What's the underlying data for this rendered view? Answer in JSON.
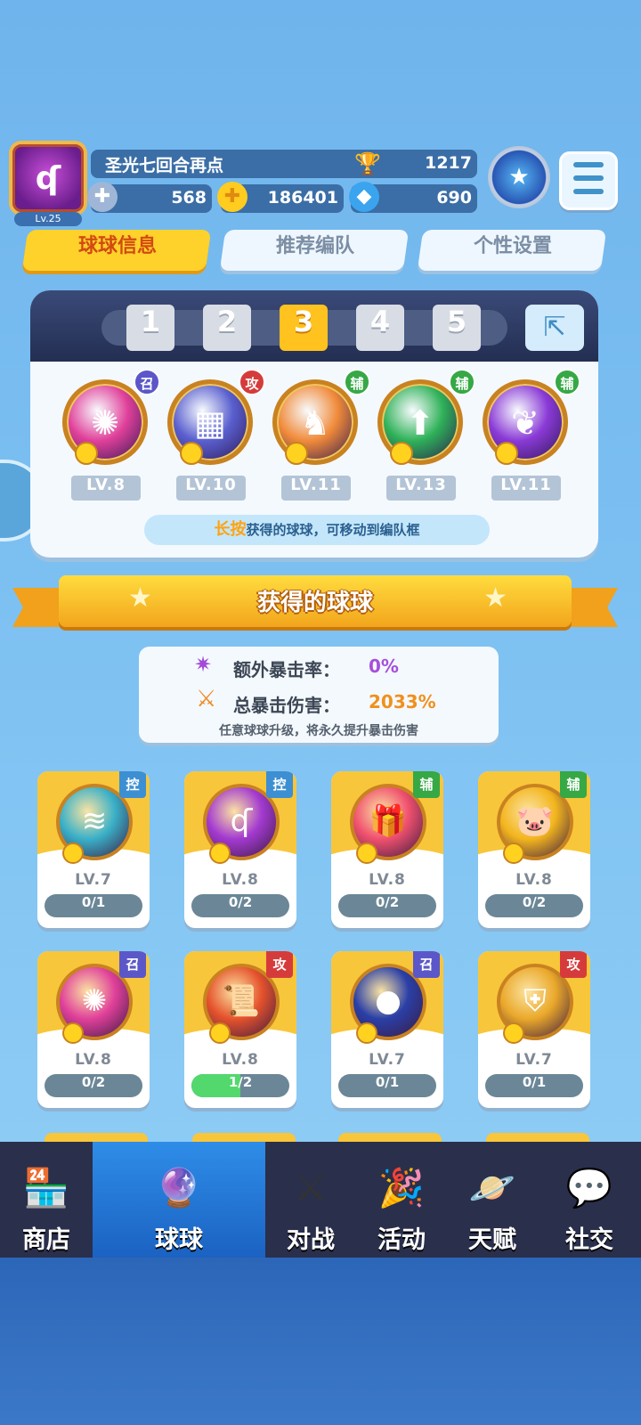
{
  "player": {
    "level": "Lv.25",
    "name": "圣光七回合再点",
    "trophies": "1217",
    "stamina": "568",
    "coins": "186401",
    "gems": "690"
  },
  "tabs": [
    {
      "label": "球球信息",
      "active": true
    },
    {
      "label": "推荐编队",
      "active": false
    },
    {
      "label": "个性设置",
      "active": false
    }
  ],
  "team": {
    "slots": [
      "1",
      "2",
      "3",
      "4",
      "5"
    ],
    "active_slot": 3,
    "balls": [
      {
        "icon": "phoenix-icon",
        "tag": "召",
        "level": "LV.8",
        "color": "#e0409a"
      },
      {
        "icon": "pixel-block-icon",
        "tag": "攻",
        "level": "LV.10",
        "color": "#5a5fcf"
      },
      {
        "icon": "silhouette-icon",
        "tag": "辅",
        "level": "LV.11",
        "color": "#f08a3a"
      },
      {
        "icon": "arrow-star-icon",
        "tag": "辅",
        "level": "LV.13",
        "color": "#2fb158"
      },
      {
        "icon": "leaf-icon",
        "tag": "辅",
        "level": "LV.11",
        "color": "#8a3ad6"
      }
    ],
    "hint_highlight": "长按",
    "hint_rest": "获得的球球，可移动到编队框"
  },
  "section": {
    "title": "获得的球球"
  },
  "crit": {
    "extra_label": "额外暴击率：",
    "extra_value": "0%",
    "total_label": "总暴击伤害：",
    "total_value": "2033%",
    "note": "任意球球升级，将永久提升暴击伤害"
  },
  "cards": [
    {
      "icon": "swirl-icon",
      "tag": "控",
      "level": "LV.7",
      "progress": "0/1",
      "fill": 0,
      "color": "#3ab0c8"
    },
    {
      "icon": "q-rune-icon",
      "tag": "控",
      "level": "LV.8",
      "progress": "0/2",
      "fill": 0,
      "color": "#a33ad0"
    },
    {
      "icon": "gift-icon",
      "tag": "辅",
      "level": "LV.8",
      "progress": "0/2",
      "fill": 0,
      "color": "#f0506e"
    },
    {
      "icon": "piggy-bank-icon",
      "tag": "辅",
      "level": "LV.8",
      "progress": "0/2",
      "fill": 0,
      "color": "#f3b51e"
    },
    {
      "icon": "phoenix-icon",
      "tag": "召",
      "level": "LV.8",
      "progress": "0/2",
      "fill": 0,
      "color": "#e0409a"
    },
    {
      "icon": "scroll-icon",
      "tag": "攻",
      "level": "LV.8",
      "progress": "1/2",
      "fill": 0.5,
      "color": "#e5522c"
    },
    {
      "icon": "dark-orb-icon",
      "tag": "召",
      "level": "LV.7",
      "progress": "0/1",
      "fill": 0,
      "color": "#2a3fa6"
    },
    {
      "icon": "armor-icon",
      "tag": "攻",
      "level": "LV.7",
      "progress": "0/1",
      "fill": 0,
      "color": "#eaa82a"
    }
  ],
  "nav": [
    {
      "label": "商店",
      "icon": "shop-icon",
      "active": false
    },
    {
      "label": "球球",
      "icon": "balls-icon",
      "active": true
    },
    {
      "label": "对战",
      "icon": "crossed-swords-icon",
      "active": false
    },
    {
      "label": "活动",
      "icon": "party-popper-icon",
      "active": false
    },
    {
      "label": "天赋",
      "icon": "planet-icon",
      "active": false
    },
    {
      "label": "社交",
      "icon": "chat-heart-icon",
      "active": false
    }
  ]
}
